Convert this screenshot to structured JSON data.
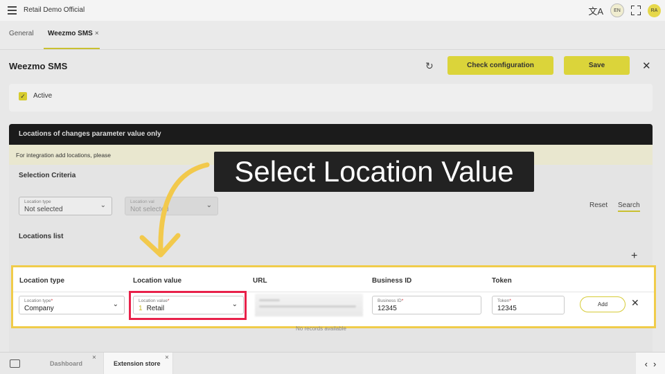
{
  "topbar": {
    "app_title": "Retail Demo Official",
    "language": "EN",
    "avatar": "RA"
  },
  "tabs": [
    {
      "label": "General"
    },
    {
      "label": "Weezmo SMS",
      "close": "×"
    }
  ],
  "header": {
    "title": "Weezmo SMS",
    "check_config_label": "Check configuration",
    "save_label": "Save",
    "close_symbol": "✕"
  },
  "active_card": {
    "label": "Active",
    "checked": true
  },
  "locations": {
    "section_title": "Locations of changes parameter value only",
    "info_text": "For integration add locations, please",
    "selection_criteria_title": "Selection Criteria",
    "filter_location_type": {
      "label": "Location type",
      "value": "Not selected"
    },
    "filter_location_value": {
      "label": "Location val",
      "value": "Not selected"
    },
    "reset_label": "Reset",
    "search_label": "Search",
    "list_title": "Locations list",
    "no_records": "No records available"
  },
  "popup_table": {
    "columns": [
      "Location type",
      "Location value",
      "URL",
      "Business ID",
      "Token"
    ],
    "row": {
      "location_type": {
        "label": "Location type",
        "value": "Company"
      },
      "location_value": {
        "label": "Location value",
        "index": "1",
        "value": "Retail"
      },
      "business_id": {
        "label": "Business ID",
        "value": "12345"
      },
      "token": {
        "label": "Token",
        "value": "12345"
      },
      "add_label": "Add",
      "remove_symbol": "✕"
    }
  },
  "callout": {
    "text": "Select Location Value"
  },
  "bottom_tabs": [
    {
      "label": "Dashboard",
      "close": "×"
    },
    {
      "label": "Extension store",
      "close": "×"
    }
  ],
  "colors": {
    "accent_yellow": "#dbd43a",
    "highlight_border": "#f0cc4a",
    "red_box": "#e8214a",
    "dark_bar": "#1b1b1b"
  }
}
